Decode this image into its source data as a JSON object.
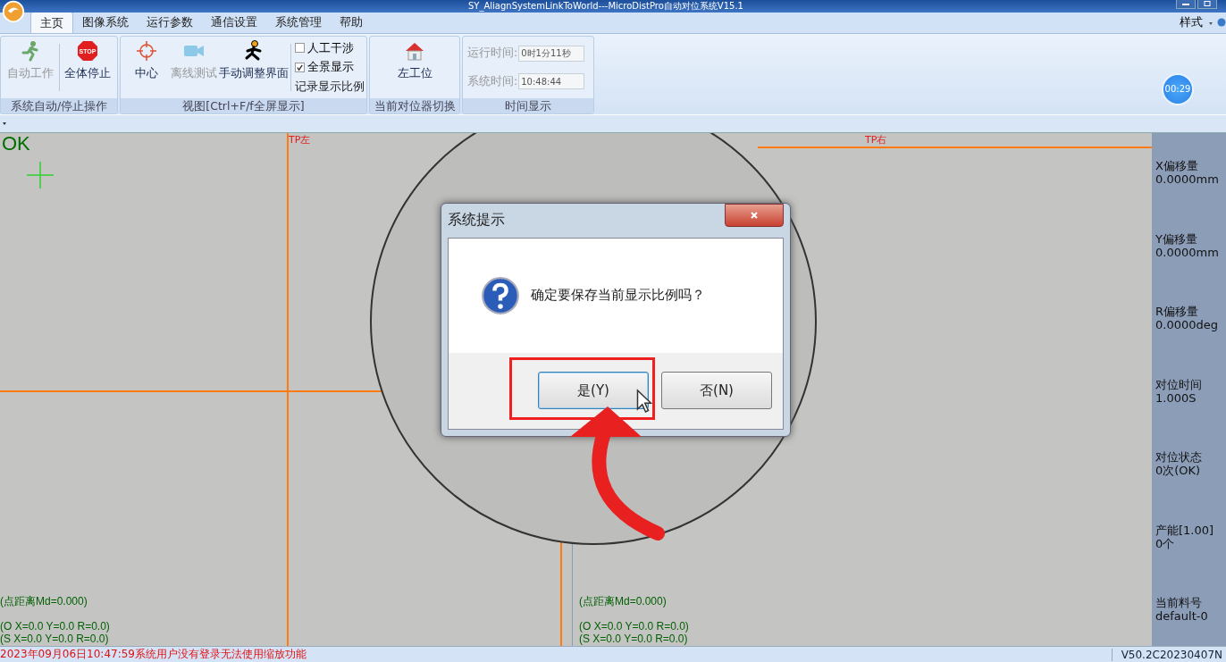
{
  "window": {
    "title": "SY_AliagnSystemLinkToWorld---MicroDistPro自动对位系统V15.1"
  },
  "tabs": [
    {
      "label": "主页",
      "selected": true
    },
    {
      "label": "图像系统",
      "selected": false
    },
    {
      "label": "运行参数",
      "selected": false
    },
    {
      "label": "通信设置",
      "selected": false
    },
    {
      "label": "系统管理",
      "selected": false
    },
    {
      "label": "帮助",
      "selected": false
    }
  ],
  "style_menu": "样式",
  "ribbon": [
    {
      "caption": "系统自动/停止操作",
      "items": [
        {
          "kind": "button",
          "label": "自动工作",
          "disabled": true
        },
        {
          "kind": "button",
          "label": "全体停止",
          "disabled": false,
          "sign_text": "STOP"
        }
      ]
    },
    {
      "caption": "视图[Ctrl+F/f全屏显示]",
      "items": [
        {
          "kind": "button",
          "label": "中心",
          "disabled": false
        },
        {
          "kind": "button",
          "label": "离线测试",
          "disabled": true
        },
        {
          "kind": "button",
          "label": "手动调整界面",
          "disabled": false
        },
        {
          "kind": "checkbox",
          "label": "人工干涉",
          "checked": false
        },
        {
          "kind": "checkbox",
          "label": "全景显示",
          "checked": true
        },
        {
          "kind": "link",
          "label": "记录显示比例"
        }
      ]
    },
    {
      "caption": "当前对位器切换",
      "items": [
        {
          "kind": "button",
          "label": "左工位",
          "disabled": false
        }
      ]
    },
    {
      "caption": "时间显示",
      "items": [
        {
          "kind": "field",
          "label": "运行时间:",
          "value": "0时1分11秒"
        },
        {
          "kind": "field",
          "label": "系统时间:",
          "value": "10:48:44"
        }
      ]
    }
  ],
  "timer": "00:29",
  "views": [
    {
      "label": "TP左",
      "status": "OK",
      "distance": "(点距离Md=0.000)",
      "o_coords": "(O X=0.0 Y=0.0 R=0.0)",
      "s_coords": "(S X=0.0 Y=0.0 R=0.0)"
    },
    {
      "label": "TP右",
      "distance": "(点距离Md=0.000)",
      "o_coords": "(O X=0.0 Y=0.0 R=0.0)",
      "s_coords": "(S X=0.0 Y=0.0 R=0.0)"
    }
  ],
  "readouts": [
    {
      "label": "X偏移量",
      "value": "0.0000mm"
    },
    {
      "label": "Y偏移量",
      "value": "0.0000mm"
    },
    {
      "label": "R偏移量",
      "value": "0.0000deg"
    },
    {
      "label": "对位时间",
      "value": "1.000S"
    },
    {
      "label": "对位状态",
      "value": "0次(OK)"
    },
    {
      "label": "产能[1.00]",
      "value": "0个"
    },
    {
      "label": "当前料号",
      "value": "default-0"
    }
  ],
  "dialog": {
    "title": "系统提示",
    "message": "确定要保存当前显示比例吗？",
    "buttons": [
      {
        "label": "是(Y)",
        "selected": true
      },
      {
        "label": "否(N)",
        "selected": false
      }
    ]
  },
  "status_bar": {
    "message": "2023年09月06日10:47:59系统用户没有登录无法使用缩放功能",
    "version": "V50.2C20230407N"
  }
}
